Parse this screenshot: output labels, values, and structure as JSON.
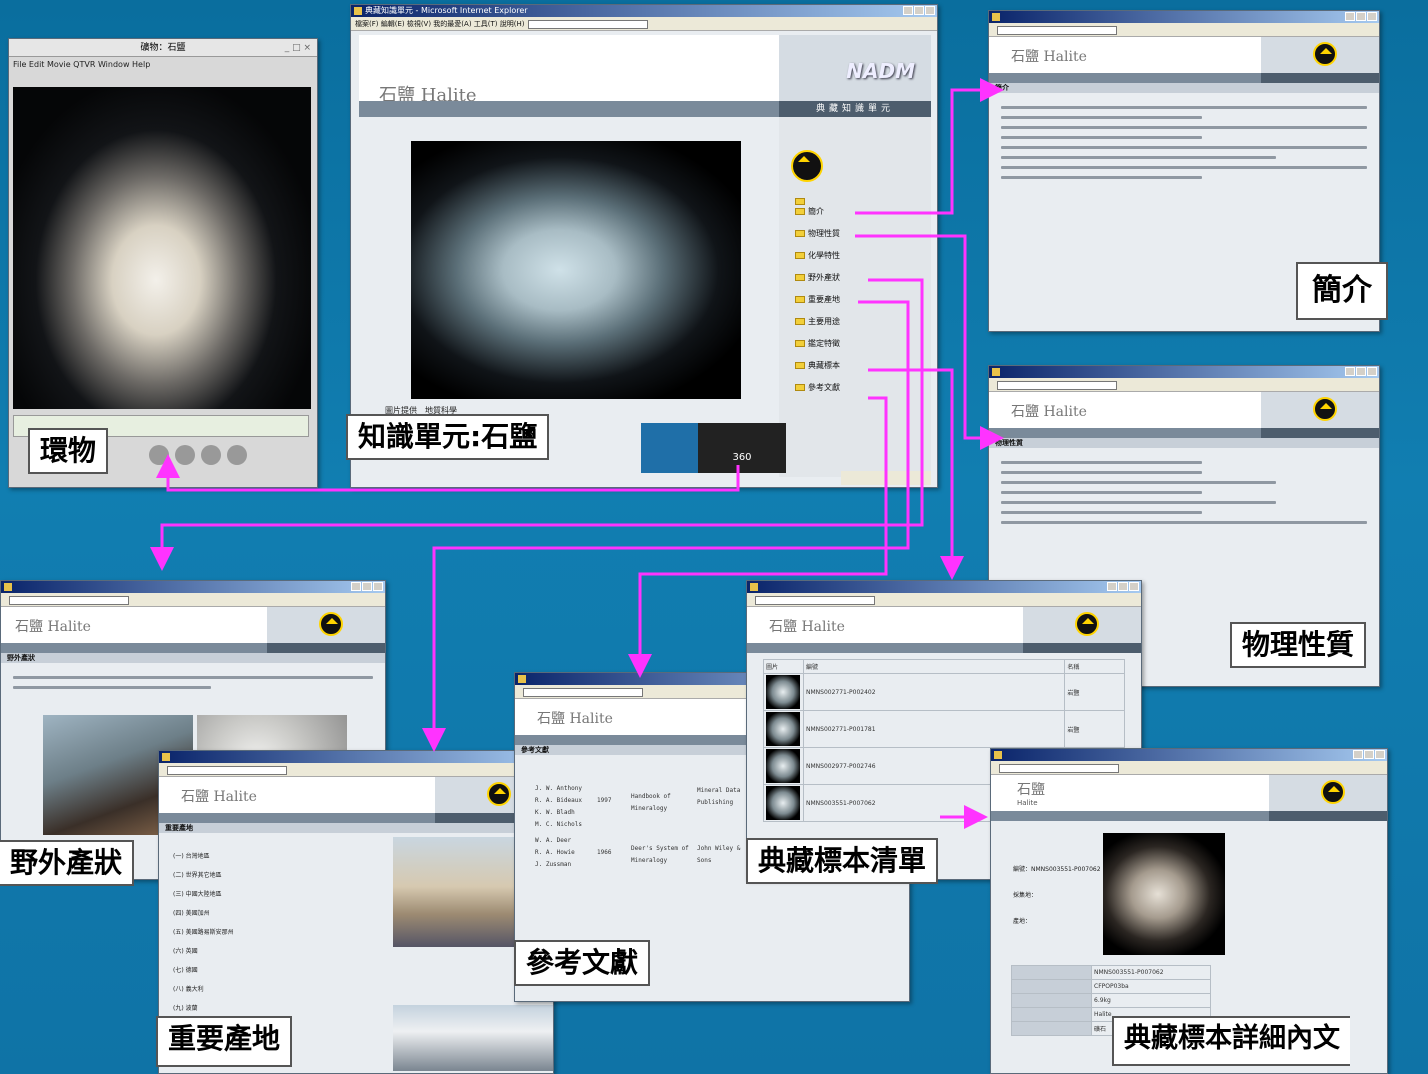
{
  "colors": {
    "background": "#117eb1",
    "arrow": "#ff33ff",
    "label_border": "#555555"
  },
  "labels": {
    "vr_object": "環物",
    "knowledge_unit": "知識單元:石鹽",
    "introduction": "簡介",
    "physical_properties": "物理性質",
    "field_occurrence": "野外產狀",
    "important_localities": "重要產地",
    "references": "參考文獻",
    "specimen_list": "典藏標本清單",
    "specimen_detail": "典藏標本詳細內文"
  },
  "main_window": {
    "title": "典藏知識單元 - Microsoft Internet Explorer",
    "menu": "檔案(F)  編輯(E)  檢視(V)  我的最愛(A)  工具(T)  說明(H)",
    "page_title": "石鹽 Halite",
    "brand": "NADM",
    "header_band": "典藏知識單元",
    "tree_items": [
      "簡介",
      "物理性質",
      "化學特性",
      "野外產狀",
      "重要產地",
      "主要用途",
      "鑑定特徵",
      "典藏標本",
      "參考文獻"
    ],
    "photo_caption": "圖片提供　地質科學",
    "vr_button": "360"
  },
  "qt_window": {
    "title": "礦物：石鹽",
    "menu": "File  Edit  Movie  QTVR  Window  Help"
  },
  "sub_windows": {
    "page_title": "石鹽 Halite",
    "detail_title": "石鹽",
    "detail_subtitle": "Halite",
    "intro_section": "簡介",
    "physical_section": "物理性質",
    "field_section": "野外產狀",
    "locality_section": "重要產地",
    "reference_section": "參考文獻",
    "list_columns": [
      "圖片",
      "編號",
      "名稱"
    ],
    "specimen_ids": [
      "NMNS002771-P002402",
      "NMNS002771-P001781",
      "NMNS002977-P002746",
      "NMNS003551-P007062"
    ],
    "specimen_names": [
      "岩鹽",
      "岩鹽",
      "岩鹽",
      "岩鹽"
    ],
    "locality_items": [
      "(一) 台灣地區",
      "(二) 世界其它地區",
      "(三) 中國大陸地區",
      "(四) 美國加州",
      "(五) 美國路易斯安那州",
      "(六) 英國",
      "(七) 德國",
      "(八) 義大利",
      "(九) 波蘭"
    ],
    "ref_authors": [
      "J. W. Anthony",
      "R. A. Bideaux",
      "K. W. Bladh",
      "M. C. Nichols",
      "W. A. Deer",
      "R. A. Howie",
      "J. Zussman"
    ],
    "ref_years": [
      "1997",
      "1966"
    ],
    "ref_titles": [
      "Handbook of Mineralogy",
      "Deer's System of Mineralogy"
    ],
    "ref_publishers": [
      "Mineral Data Publishing",
      "John Wiley & Sons"
    ],
    "detail_fields": [
      "編號：NMNS003551-P007062",
      "採集地：",
      "產地："
    ],
    "detail_table": [
      "NMNS003551-P007062",
      "CFPOP03ba",
      "6.9kg",
      "Halite",
      "礦石"
    ]
  }
}
